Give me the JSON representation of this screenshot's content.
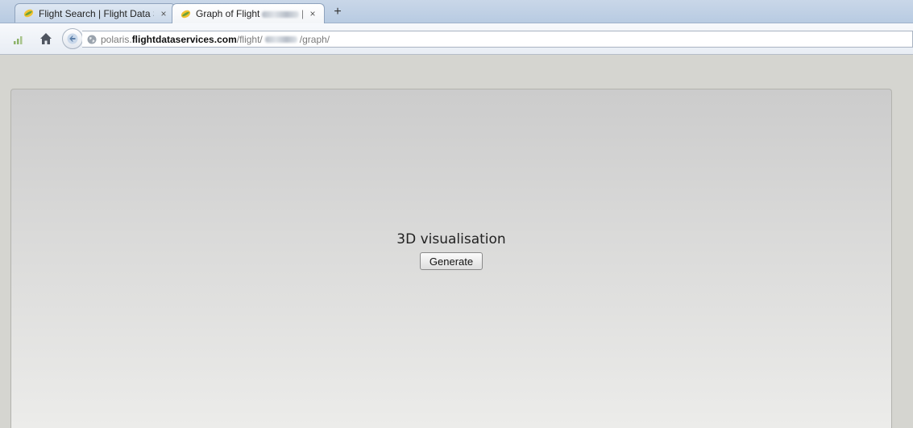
{
  "browser": {
    "tabs": [
      {
        "label": "Flight Search | Flight Data S...",
        "close": "×",
        "active": false
      },
      {
        "label_prefix": "Graph of Flight",
        "label_suffix": "| ...",
        "close": "×",
        "active": true
      }
    ],
    "new_tab": "+",
    "url": {
      "subdomain": "polaris.",
      "domain": "flightdataservices.com",
      "path_prefix": "/flight/",
      "path_suffix": "/graph/"
    },
    "icons": [
      "signal-icon",
      "home-icon",
      "back-arrow-icon",
      "globe-icon",
      "favicon"
    ]
  },
  "page": {
    "visualisation_title": "3D visualisation",
    "generate_label": "Generate"
  },
  "colors": {
    "tabstrip": "#b8cbe2",
    "panel_top": "#cccccc",
    "panel_bottom": "#ececea"
  }
}
